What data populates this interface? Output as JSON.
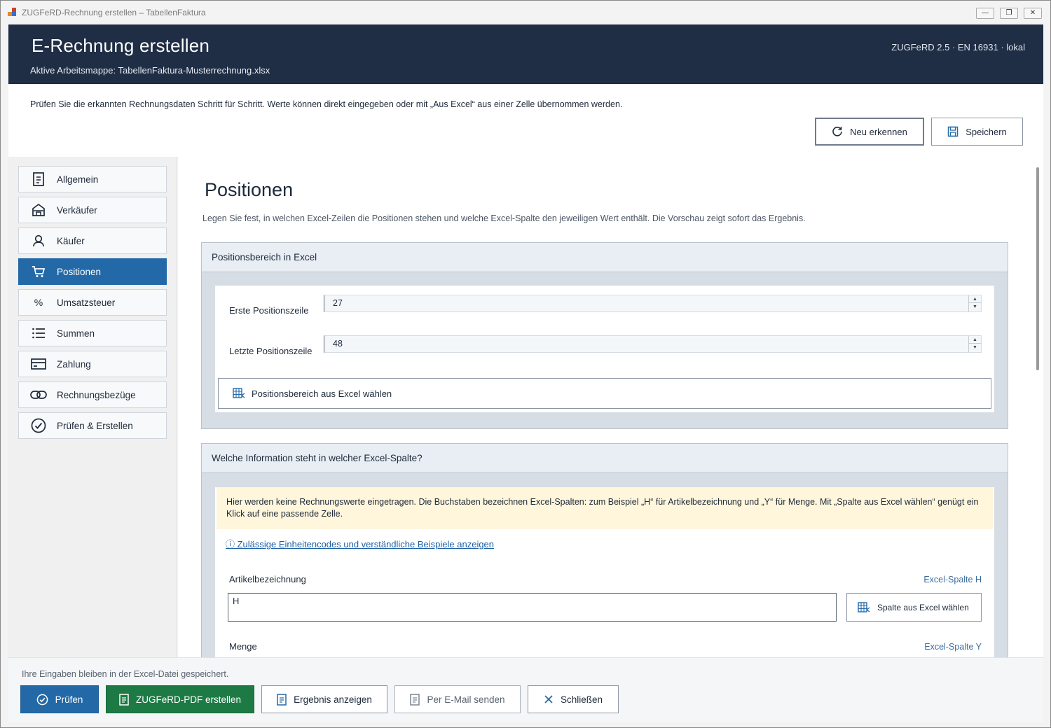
{
  "window": {
    "title": "ZUGFeRD-Rechnung erstellen – TabellenFaktura",
    "minimize": "—",
    "maximize": "❐",
    "close": "✕"
  },
  "header": {
    "title": "E-Rechnung erstellen",
    "subtitle": "Aktive Arbeitsmappe: TabellenFaktura-Musterrechnung.xlsx",
    "meta": "ZUGFeRD 2.5 · EN 16931 · lokal"
  },
  "intro": {
    "text": "Prüfen Sie die erkannten Rechnungsdaten Schritt für Schritt. Werte können direkt eingegeben oder mit „Aus Excel“ aus einer Zelle übernommen werden.",
    "recognize_label": "Neu erkennen",
    "save_label": "Speichern"
  },
  "sidebar": {
    "items": [
      {
        "label": "Allgemein",
        "icon": "document-icon"
      },
      {
        "label": "Verkäufer",
        "icon": "store-icon"
      },
      {
        "label": "Käufer",
        "icon": "user-icon"
      },
      {
        "label": "Positionen",
        "icon": "cart-icon",
        "active": true
      },
      {
        "label": "Umsatzsteuer",
        "icon": "percent-icon"
      },
      {
        "label": "Summen",
        "icon": "list-icon"
      },
      {
        "label": "Zahlung",
        "icon": "card-icon"
      },
      {
        "label": "Rechnungsbezüge",
        "icon": "link-icon"
      },
      {
        "label": "Prüfen & Erstellen",
        "icon": "check-circle-icon"
      }
    ],
    "percent_glyph": "%"
  },
  "main": {
    "title": "Positionen",
    "description": "Legen Sie fest, in welchen Excel-Zeilen die Positionen stehen und welche Excel-Spalte den jeweiligen Wert enthält. Die Vorschau zeigt sofort das Ergebnis.",
    "range_section": {
      "title": "Positionsbereich in Excel",
      "first_row_label": "Erste Positionszeile",
      "first_row_value": "27",
      "last_row_label": "Letzte Positionszeile",
      "last_row_value": "48",
      "pick_range_label": "Positionsbereich aus Excel wählen"
    },
    "columns_section": {
      "title": "Welche Information steht in welcher Excel-Spalte?",
      "hint": "Hier werden keine Rechnungswerte eingetragen. Die Buchstaben bezeichnen Excel-Spalten: zum Beispiel „H“ für Artikelbezeichnung und „Y“ für Menge. Mit „Spalte aus Excel wählen“ genügt ein Klick auf eine passende Zelle.",
      "units_link": "ⓘ Zulässige Einheitencodes und verständliche Beispiele anzeigen",
      "article_label": "Artikelbezeichnung",
      "article_column_tag": "Excel-Spalte H",
      "article_value": "H",
      "pick_column_label": "Spalte aus Excel wählen",
      "quantity_label": "Menge",
      "quantity_column_tag": "Excel-Spalte Y"
    }
  },
  "footer": {
    "note": "Ihre Eingaben bleiben in der Excel-Datei gespeichert.",
    "check_label": "Prüfen",
    "create_label": "ZUGFeRD-PDF erstellen",
    "show_result_label": "Ergebnis anzeigen",
    "email_label": "Per E-Mail senden",
    "close_label": "Schließen"
  },
  "colors": {
    "header_bg": "#1f2d45",
    "accent_blue": "#2369a8",
    "accent_green": "#1d7a45",
    "hint_bg": "#fff6dc"
  }
}
